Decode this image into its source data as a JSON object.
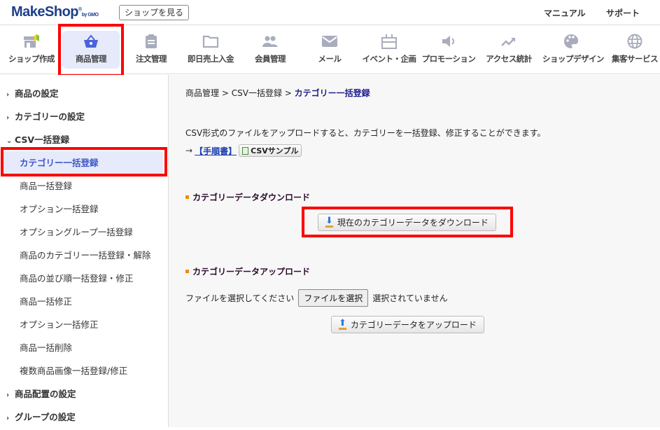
{
  "header": {
    "logo": "MakeShop",
    "logo_suffix": "by GMO",
    "view_shop": "ショップを見る",
    "manual": "マニュアル",
    "support": "サポート"
  },
  "nav": [
    {
      "label": "ショップ作成",
      "icon": "store-icon"
    },
    {
      "label": "商品管理",
      "icon": "basket-icon",
      "active": true
    },
    {
      "label": "注文管理",
      "icon": "clipboard-icon"
    },
    {
      "label": "即日売上入金",
      "icon": "folder-icon"
    },
    {
      "label": "会員管理",
      "icon": "people-icon"
    },
    {
      "label": "メール",
      "icon": "mail-icon"
    },
    {
      "label": "イベント・企画",
      "icon": "gift-icon"
    },
    {
      "label": "プロモーション",
      "icon": "speaker-icon"
    },
    {
      "label": "アクセス統計",
      "icon": "trend-icon"
    },
    {
      "label": "ショップデザイン",
      "icon": "palette-icon"
    },
    {
      "label": "集客サービス",
      "icon": "globe-icon"
    }
  ],
  "sidebar": [
    {
      "label": "商品の設定",
      "type": "top"
    },
    {
      "label": "カテゴリーの設定",
      "type": "top"
    },
    {
      "label": "CSV一括登録",
      "type": "top-open"
    },
    {
      "label": "カテゴリー一括登録",
      "type": "current"
    },
    {
      "label": "商品一括登録",
      "type": "sub"
    },
    {
      "label": "オプション一括登録",
      "type": "sub"
    },
    {
      "label": "オプショングループ一括登録",
      "type": "sub"
    },
    {
      "label": "商品のカテゴリー一括登録・解除",
      "type": "sub"
    },
    {
      "label": "商品の並び順一括登録・修正",
      "type": "sub"
    },
    {
      "label": "商品一括修正",
      "type": "sub"
    },
    {
      "label": "オプション一括修正",
      "type": "sub"
    },
    {
      "label": "商品一括削除",
      "type": "sub"
    },
    {
      "label": "複数商品画像一括登録/修正",
      "type": "sub"
    },
    {
      "label": "商品配置の設定",
      "type": "top"
    },
    {
      "label": "グループの設定",
      "type": "top"
    }
  ],
  "main": {
    "breadcrumb": [
      "商品管理",
      "CSV一括登録",
      "カテゴリー一括登録"
    ],
    "breadcrumb_sep": ">",
    "description": "CSV形式のファイルをアップロードすると、カテゴリーを一括登録、修正することができます。",
    "arrow": "→",
    "manual_link": "【手順書】",
    "csv_sample": "CSVサンプル",
    "download_section": "カテゴリーデータダウンロード",
    "download_button": "現在のカテゴリーデータをダウンロード",
    "upload_section": "カテゴリーデータアップロード",
    "file_prompt": "ファイルを選択してください",
    "file_button": "ファイルを選択",
    "file_status": "選択されていません",
    "upload_button": "カテゴリーデータをアップロード"
  },
  "colors": {
    "accent": "#3f56c9",
    "highlight": "#ff0000",
    "active_bg": "#e6eafb"
  }
}
